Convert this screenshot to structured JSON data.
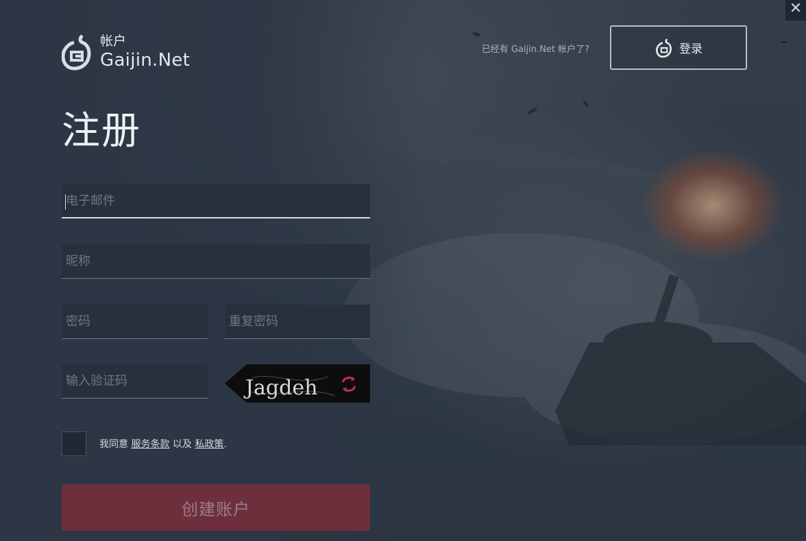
{
  "header": {
    "logo_sub": "帐户",
    "logo_name": "Gaijin.Net",
    "have_account_text": "已经有 Gaijin.Net 帐户了?",
    "login_label": "登录",
    "close_icon": "✕"
  },
  "page": {
    "title": "注册"
  },
  "form": {
    "email_placeholder": "电子邮件",
    "nickname_placeholder": "昵称",
    "password_placeholder": "密码",
    "repeat_password_placeholder": "重复密码",
    "captcha_placeholder": "输入验证码",
    "captcha_text": "Jagdeh",
    "agree_prefix": "我同意",
    "terms_link": "服务条款",
    "and_text": "以及",
    "privacy_link": "私政策",
    "agree_suffix": ".",
    "create_label": "创建账户"
  },
  "colors": {
    "background": "#2c3644",
    "field_background": "#27313d",
    "create_button": "#6e2f3d",
    "refresh_icon": "#c0353f"
  }
}
